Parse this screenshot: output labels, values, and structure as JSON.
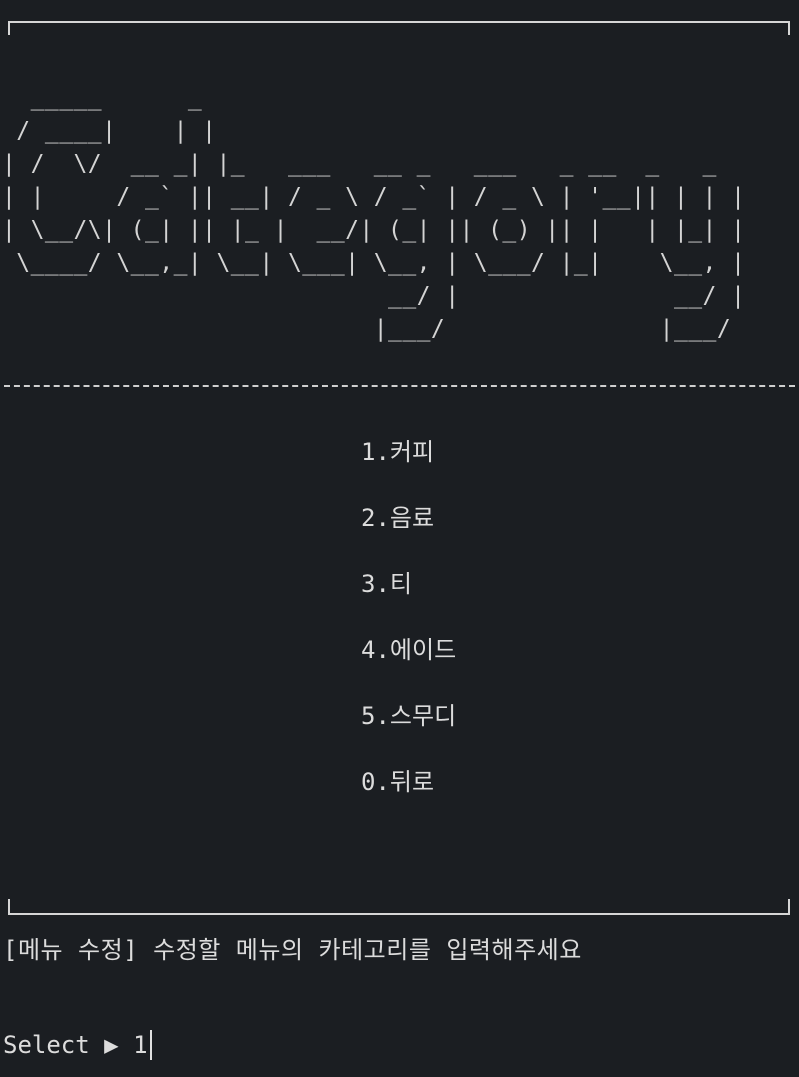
{
  "banner": {
    "title": "Category",
    "ascii_art": "  _____      _\n / ____|    | |\n| /  \\/  __ _| |_   ___   __ _   ___   _ __  _   _\n| |     / _` || __| / _ \\ / _` | / _ \\ | '__|| | | |\n| \\__/\\| (_| || |_ |  __/| (_| || (_) || |   | |_| |\n \\____/ \\__,_| \\__| \\___| \\__, | \\___/ |_|    \\__, |\n                           __/ |               __/ |\n                          |___/               |___/"
  },
  "menu": {
    "items": [
      {
        "number": "1",
        "label": "커피"
      },
      {
        "number": "2",
        "label": "음료"
      },
      {
        "number": "3",
        "label": "티"
      },
      {
        "number": "4",
        "label": "에이드"
      },
      {
        "number": "5",
        "label": "스무디"
      },
      {
        "number": "0",
        "label": "뒤로"
      }
    ]
  },
  "prompt": {
    "message": "[메뉴 수정] 수정할 메뉴의 카테고리를 입력해주세요"
  },
  "input": {
    "label": "Select",
    "arrow": "▶",
    "value": "1"
  }
}
